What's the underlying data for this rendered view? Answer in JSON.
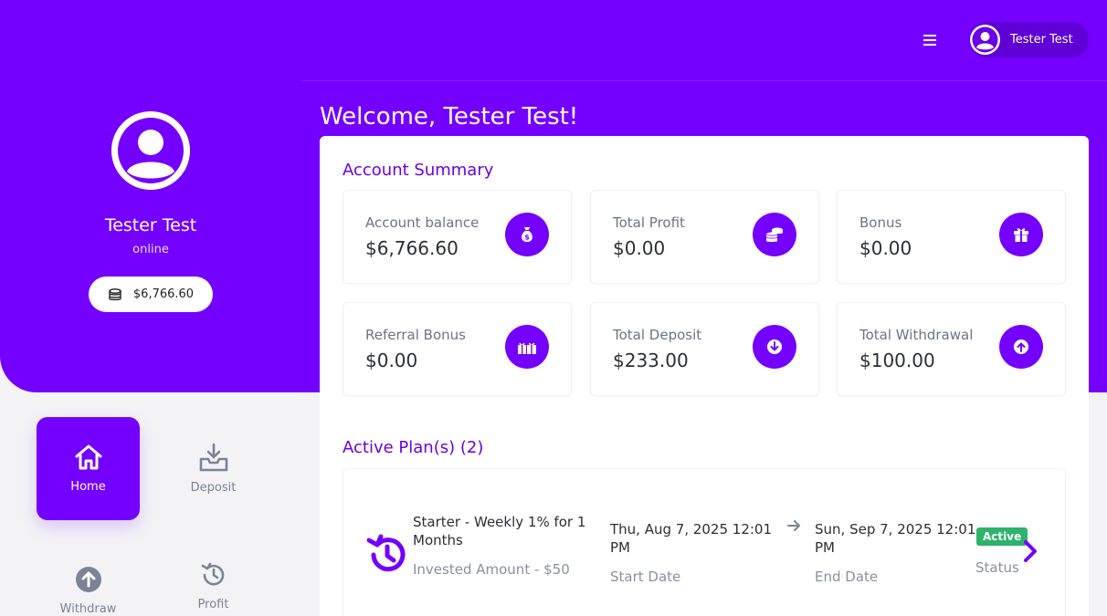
{
  "header": {
    "menu_icon": "hamburger-icon",
    "user_name": "Tester Test"
  },
  "profile": {
    "name": "Tester Test",
    "status": "online",
    "balance": "$6,766.60"
  },
  "nav": {
    "items": [
      {
        "label": "Home",
        "icon": "home-icon",
        "active": true
      },
      {
        "label": "Deposit",
        "icon": "deposit-icon",
        "active": false
      },
      {
        "label": "Withdraw",
        "icon": "withdraw-icon",
        "active": false
      },
      {
        "label": "Profit",
        "icon": "history-icon",
        "active": false
      }
    ]
  },
  "main": {
    "welcome": "Welcome, Tester Test!",
    "summary_title": "Account Summary",
    "stats": [
      {
        "label": "Account balance",
        "value": "$6,766.60",
        "icon": "money-bag-icon"
      },
      {
        "label": "Total Profit",
        "value": "$0.00",
        "icon": "coins-icon"
      },
      {
        "label": "Bonus",
        "value": "$0.00",
        "icon": "gift-icon"
      },
      {
        "label": "Referral Bonus",
        "value": "$0.00",
        "icon": "gifts-icon"
      },
      {
        "label": "Total Deposit",
        "value": "$233.00",
        "icon": "arrow-down-circle-icon"
      },
      {
        "label": "Total Withdrawal",
        "value": "$100.00",
        "icon": "arrow-up-circle-icon"
      }
    ],
    "plans_title": "Active Plan(s) (2)",
    "plan": {
      "name": "Starter - Weekly 1% for 1 Months",
      "amount": "Invested Amount - $50",
      "start_date": "Thu, Aug 7, 2025 12:01 PM",
      "start_label": "Start Date",
      "end_date": "Sun, Sep 7, 2025 12:01 PM",
      "end_label": "End Date",
      "badge": "Active",
      "status_label": "Status"
    }
  },
  "colors": {
    "brand": "#7400ff",
    "success": "#2db36c"
  }
}
